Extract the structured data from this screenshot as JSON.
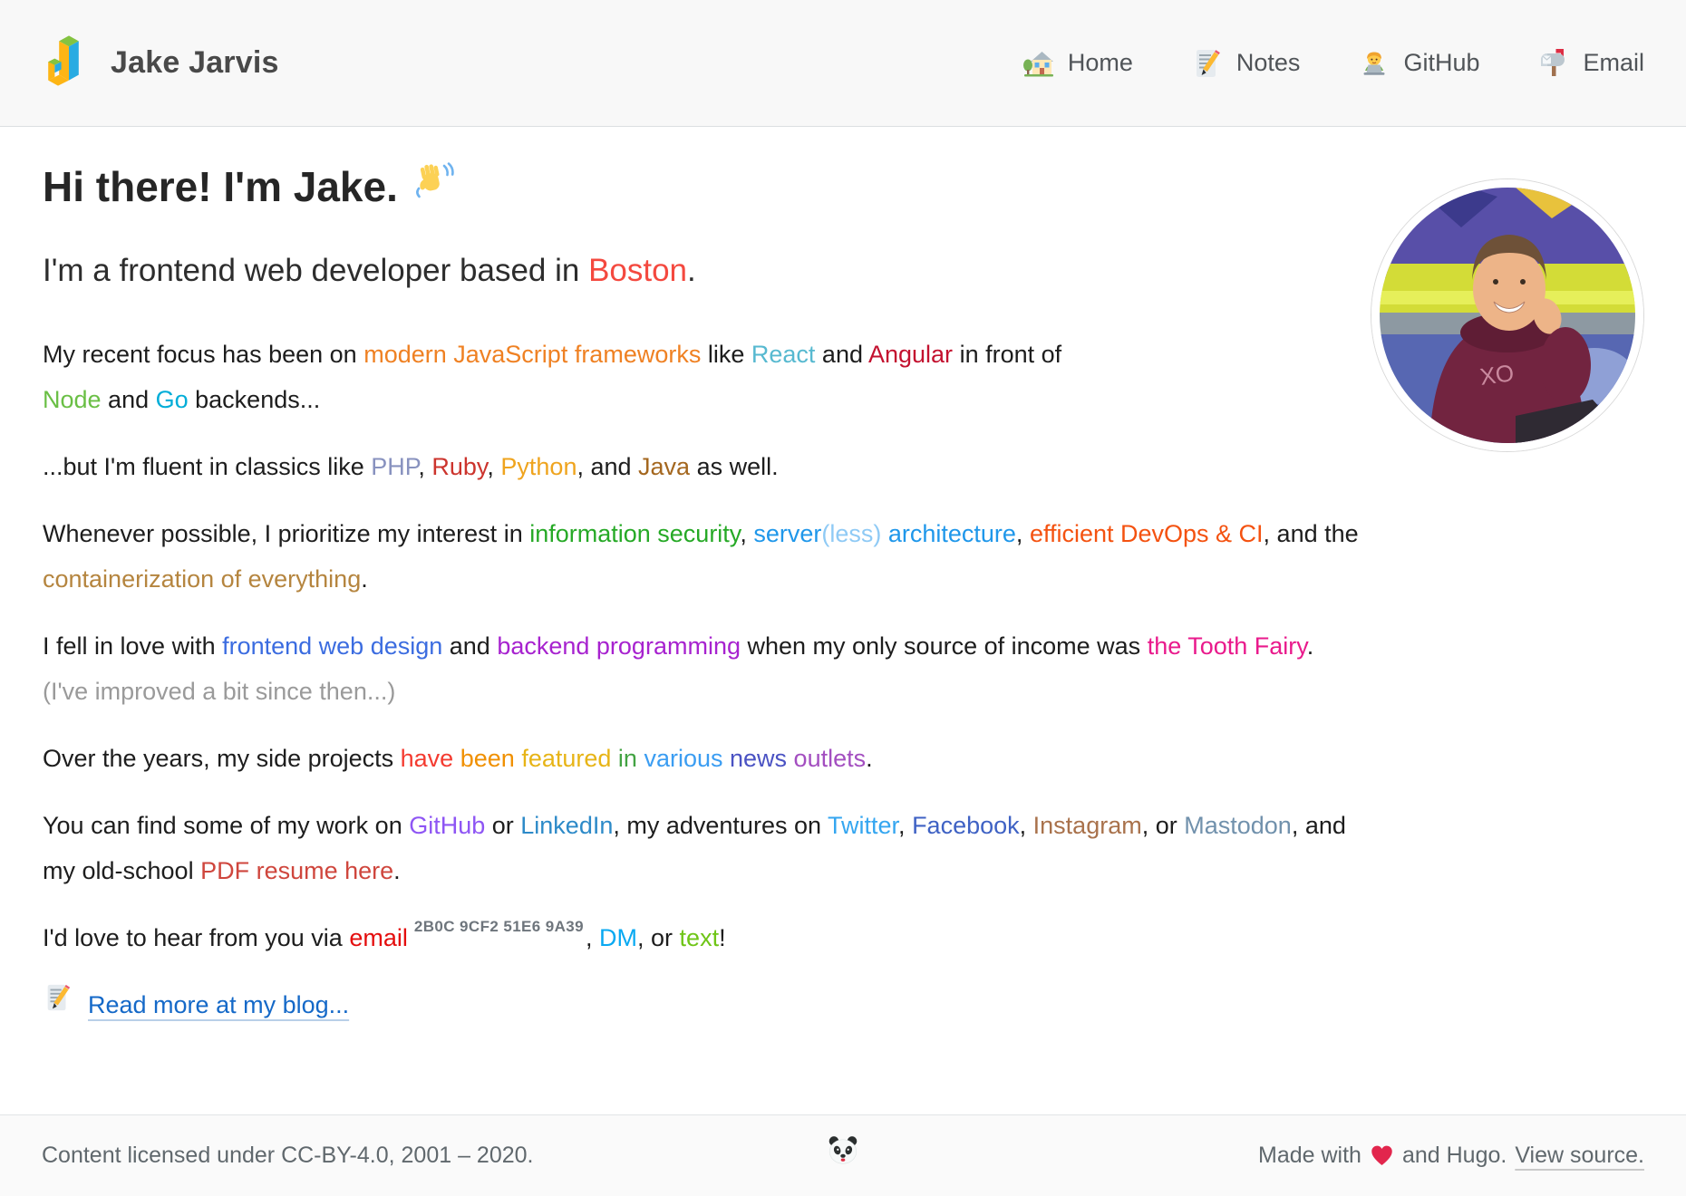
{
  "header": {
    "title": "Jake Jarvis",
    "nav": [
      {
        "icon": "house-icon",
        "label": "Home"
      },
      {
        "icon": "memo-icon",
        "label": "Notes"
      },
      {
        "icon": "technologist-icon",
        "label": "GitHub"
      },
      {
        "icon": "mailbox-icon",
        "label": "Email"
      }
    ]
  },
  "main": {
    "heading": "Hi there! I'm Jake.",
    "heading_emoji": "waving-hand-icon",
    "subheading": [
      {
        "t": "I'm a frontend web developer based in "
      },
      {
        "t": "Boston",
        "c": "#f4493f"
      },
      {
        "t": "."
      }
    ],
    "p_focus": [
      {
        "t": "My recent focus has been on "
      },
      {
        "t": "modern JavaScript frameworks",
        "c": "#ef8123"
      },
      {
        "t": " like "
      },
      {
        "t": "React",
        "c": "#57b9d0"
      },
      {
        "t": " and "
      },
      {
        "t": "Angular",
        "c": "#c3112f"
      },
      {
        "t": " in front of"
      },
      {
        "t": "Node",
        "c": "#6abf45"
      },
      {
        "t": " and "
      },
      {
        "t": "Go",
        "c": "#00add8"
      },
      {
        "t": " backends..."
      }
    ],
    "p_classics": [
      {
        "t": "...but I'm fluent in classics like "
      },
      {
        "t": "PHP",
        "c": "#8892bf"
      },
      {
        "t": ", "
      },
      {
        "t": "Ruby",
        "c": "#cc342d"
      },
      {
        "t": ", "
      },
      {
        "t": "Python",
        "c": "#efa41e"
      },
      {
        "t": ", and "
      },
      {
        "t": "Java",
        "c": "#a4671f"
      },
      {
        "t": " as well."
      }
    ],
    "p_interests": [
      {
        "t": "Whenever possible, I prioritize my interest in "
      },
      {
        "t": "information security",
        "c": "#26a926"
      },
      {
        "t": ", "
      },
      {
        "t": "server",
        "c": "#1f97ea"
      },
      {
        "t": "(less)",
        "c": "#8fcaf5"
      },
      {
        "t": " architecture",
        "c": "#1f97ea"
      },
      {
        "t": ", "
      },
      {
        "t": "efficient DevOps & CI",
        "c": "#f45210"
      },
      {
        "t": ", and the"
      },
      {
        "t": "containerization of everything",
        "c": "#b5853f"
      },
      {
        "t": "."
      }
    ],
    "p_love": [
      {
        "t": "I fell in love with "
      },
      {
        "t": "frontend web design",
        "c": "#3b6ce0"
      },
      {
        "t": " and "
      },
      {
        "t": "backend programming",
        "c": "#a722cf"
      },
      {
        "t": " when my only source of income was "
      },
      {
        "t": "the Tooth Fairy",
        "c": "#e91a8c"
      },
      {
        "t": "."
      },
      {
        "t": "(I've improved a bit since then...)",
        "c": "#9a9a9a"
      }
    ],
    "p_featured": [
      {
        "t": "Over the years, my side projects "
      },
      {
        "t": "have",
        "c": "#f43b30"
      },
      {
        "t": " "
      },
      {
        "t": "been",
        "c": "#f09000"
      },
      {
        "t": " "
      },
      {
        "t": "featured",
        "c": "#e7b416"
      },
      {
        "t": " "
      },
      {
        "t": "in",
        "c": "#43a343"
      },
      {
        "t": " "
      },
      {
        "t": "various",
        "c": "#3b9df2"
      },
      {
        "t": " "
      },
      {
        "t": "news",
        "c": "#4a52c3"
      },
      {
        "t": " "
      },
      {
        "t": "outlets",
        "c": "#a34ec0"
      },
      {
        "t": "."
      }
    ],
    "p_find": [
      {
        "t": "You can find some of my work on "
      },
      {
        "t": "GitHub",
        "c": "#8e55f4"
      },
      {
        "t": " or "
      },
      {
        "t": "LinkedIn",
        "c": "#2d8ac8"
      },
      {
        "t": ", my adventures on "
      },
      {
        "t": "Twitter",
        "c": "#35a6f0"
      },
      {
        "t": ", "
      },
      {
        "t": "Facebook",
        "c": "#3f62c4"
      },
      {
        "t": ", "
      },
      {
        "t": "Instagram",
        "c": "#a9724c"
      },
      {
        "t": ", or "
      },
      {
        "t": "Mastodon",
        "c": "#7191ac"
      },
      {
        "t": ", and"
      },
      {
        "t": "my old-school "
      },
      {
        "t": "PDF resume here",
        "c": "#cf463d"
      },
      {
        "t": "."
      }
    ],
    "p_contact": [
      {
        "t": "I'd love to hear from you via "
      },
      {
        "t": "email",
        "c": "#e40d0d"
      },
      {
        "t": "2B0C 9CF2 51E6 9A39",
        "c": "#6e757c"
      },
      {
        "t": ", "
      },
      {
        "t": "DM",
        "c": "#09a9f2"
      },
      {
        "t": ", or "
      },
      {
        "t": "text",
        "c": "#6fc517"
      },
      {
        "t": "!"
      }
    ],
    "blog": {
      "icon": "memo-icon",
      "label": "Read more at my blog...",
      "color": "#1569c8"
    }
  },
  "footer": {
    "license": "Content licensed under CC-BY-4.0, 2001 – 2020.",
    "center_emoji": "panda-icon",
    "made_prefix": "Made with",
    "made_heart": "heart-icon",
    "made_suffix": "and Hugo.",
    "view_source": "View source."
  }
}
